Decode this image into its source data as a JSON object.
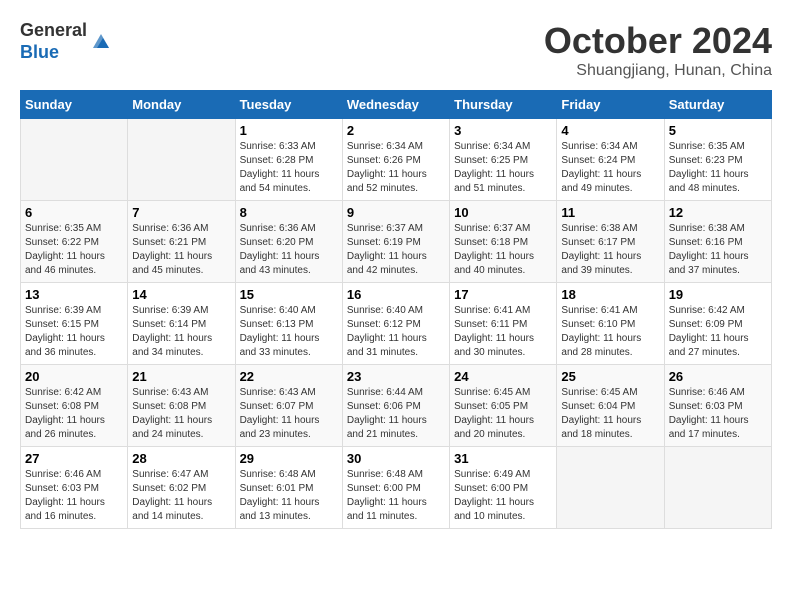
{
  "header": {
    "logo_line1": "General",
    "logo_line2": "Blue",
    "month": "October 2024",
    "location": "Shuangjiang, Hunan, China"
  },
  "weekdays": [
    "Sunday",
    "Monday",
    "Tuesday",
    "Wednesday",
    "Thursday",
    "Friday",
    "Saturday"
  ],
  "weeks": [
    [
      {
        "day": "",
        "info": ""
      },
      {
        "day": "",
        "info": ""
      },
      {
        "day": "1",
        "info": "Sunrise: 6:33 AM\nSunset: 6:28 PM\nDaylight: 11 hours and 54 minutes."
      },
      {
        "day": "2",
        "info": "Sunrise: 6:34 AM\nSunset: 6:26 PM\nDaylight: 11 hours and 52 minutes."
      },
      {
        "day": "3",
        "info": "Sunrise: 6:34 AM\nSunset: 6:25 PM\nDaylight: 11 hours and 51 minutes."
      },
      {
        "day": "4",
        "info": "Sunrise: 6:34 AM\nSunset: 6:24 PM\nDaylight: 11 hours and 49 minutes."
      },
      {
        "day": "5",
        "info": "Sunrise: 6:35 AM\nSunset: 6:23 PM\nDaylight: 11 hours and 48 minutes."
      }
    ],
    [
      {
        "day": "6",
        "info": "Sunrise: 6:35 AM\nSunset: 6:22 PM\nDaylight: 11 hours and 46 minutes."
      },
      {
        "day": "7",
        "info": "Sunrise: 6:36 AM\nSunset: 6:21 PM\nDaylight: 11 hours and 45 minutes."
      },
      {
        "day": "8",
        "info": "Sunrise: 6:36 AM\nSunset: 6:20 PM\nDaylight: 11 hours and 43 minutes."
      },
      {
        "day": "9",
        "info": "Sunrise: 6:37 AM\nSunset: 6:19 PM\nDaylight: 11 hours and 42 minutes."
      },
      {
        "day": "10",
        "info": "Sunrise: 6:37 AM\nSunset: 6:18 PM\nDaylight: 11 hours and 40 minutes."
      },
      {
        "day": "11",
        "info": "Sunrise: 6:38 AM\nSunset: 6:17 PM\nDaylight: 11 hours and 39 minutes."
      },
      {
        "day": "12",
        "info": "Sunrise: 6:38 AM\nSunset: 6:16 PM\nDaylight: 11 hours and 37 minutes."
      }
    ],
    [
      {
        "day": "13",
        "info": "Sunrise: 6:39 AM\nSunset: 6:15 PM\nDaylight: 11 hours and 36 minutes."
      },
      {
        "day": "14",
        "info": "Sunrise: 6:39 AM\nSunset: 6:14 PM\nDaylight: 11 hours and 34 minutes."
      },
      {
        "day": "15",
        "info": "Sunrise: 6:40 AM\nSunset: 6:13 PM\nDaylight: 11 hours and 33 minutes."
      },
      {
        "day": "16",
        "info": "Sunrise: 6:40 AM\nSunset: 6:12 PM\nDaylight: 11 hours and 31 minutes."
      },
      {
        "day": "17",
        "info": "Sunrise: 6:41 AM\nSunset: 6:11 PM\nDaylight: 11 hours and 30 minutes."
      },
      {
        "day": "18",
        "info": "Sunrise: 6:41 AM\nSunset: 6:10 PM\nDaylight: 11 hours and 28 minutes."
      },
      {
        "day": "19",
        "info": "Sunrise: 6:42 AM\nSunset: 6:09 PM\nDaylight: 11 hours and 27 minutes."
      }
    ],
    [
      {
        "day": "20",
        "info": "Sunrise: 6:42 AM\nSunset: 6:08 PM\nDaylight: 11 hours and 26 minutes."
      },
      {
        "day": "21",
        "info": "Sunrise: 6:43 AM\nSunset: 6:08 PM\nDaylight: 11 hours and 24 minutes."
      },
      {
        "day": "22",
        "info": "Sunrise: 6:43 AM\nSunset: 6:07 PM\nDaylight: 11 hours and 23 minutes."
      },
      {
        "day": "23",
        "info": "Sunrise: 6:44 AM\nSunset: 6:06 PM\nDaylight: 11 hours and 21 minutes."
      },
      {
        "day": "24",
        "info": "Sunrise: 6:45 AM\nSunset: 6:05 PM\nDaylight: 11 hours and 20 minutes."
      },
      {
        "day": "25",
        "info": "Sunrise: 6:45 AM\nSunset: 6:04 PM\nDaylight: 11 hours and 18 minutes."
      },
      {
        "day": "26",
        "info": "Sunrise: 6:46 AM\nSunset: 6:03 PM\nDaylight: 11 hours and 17 minutes."
      }
    ],
    [
      {
        "day": "27",
        "info": "Sunrise: 6:46 AM\nSunset: 6:03 PM\nDaylight: 11 hours and 16 minutes."
      },
      {
        "day": "28",
        "info": "Sunrise: 6:47 AM\nSunset: 6:02 PM\nDaylight: 11 hours and 14 minutes."
      },
      {
        "day": "29",
        "info": "Sunrise: 6:48 AM\nSunset: 6:01 PM\nDaylight: 11 hours and 13 minutes."
      },
      {
        "day": "30",
        "info": "Sunrise: 6:48 AM\nSunset: 6:00 PM\nDaylight: 11 hours and 11 minutes."
      },
      {
        "day": "31",
        "info": "Sunrise: 6:49 AM\nSunset: 6:00 PM\nDaylight: 11 hours and 10 minutes."
      },
      {
        "day": "",
        "info": ""
      },
      {
        "day": "",
        "info": ""
      }
    ]
  ]
}
